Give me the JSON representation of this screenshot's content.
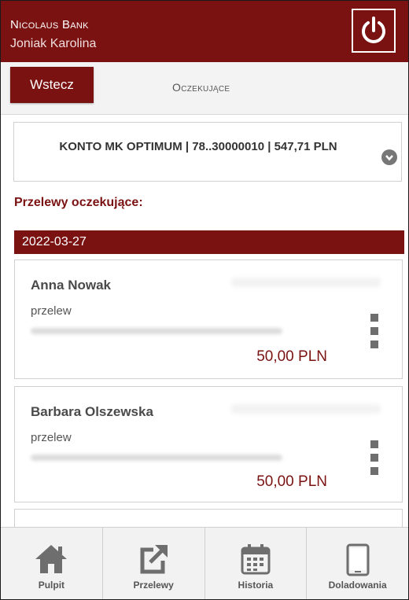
{
  "header": {
    "bank_name": "Nicolaus Bank",
    "user_name": "Joniak Karolina",
    "logout_icon": "power-icon"
  },
  "subbar": {
    "back_label": "Wstecz",
    "title": "Oczekujące"
  },
  "account": {
    "label": "KONTO MK OPTIMUM | 78..30000010 | 547,71 PLN",
    "chevron_icon": "chevron-down-icon"
  },
  "section_title": "Przelewy oczekujące:",
  "date_group": "2022-03-27",
  "transfers": [
    {
      "name": "Anna Nowak",
      "type": "przelew",
      "amount": "50,00 PLN"
    },
    {
      "name": "Barbara Olszewska",
      "type": "przelew",
      "amount": "50,00 PLN"
    }
  ],
  "bottom_nav": [
    {
      "label": "Pulpit",
      "icon": "home-icon"
    },
    {
      "label": "Przelewy",
      "icon": "share-arrow-icon"
    },
    {
      "label": "Historia",
      "icon": "calendar-icon"
    },
    {
      "label": "Doladowania",
      "icon": "phone-icon"
    }
  ],
  "colors": {
    "brand": "#7a1212",
    "background": "#ffffff",
    "nav_background": "#f2f2f2"
  }
}
